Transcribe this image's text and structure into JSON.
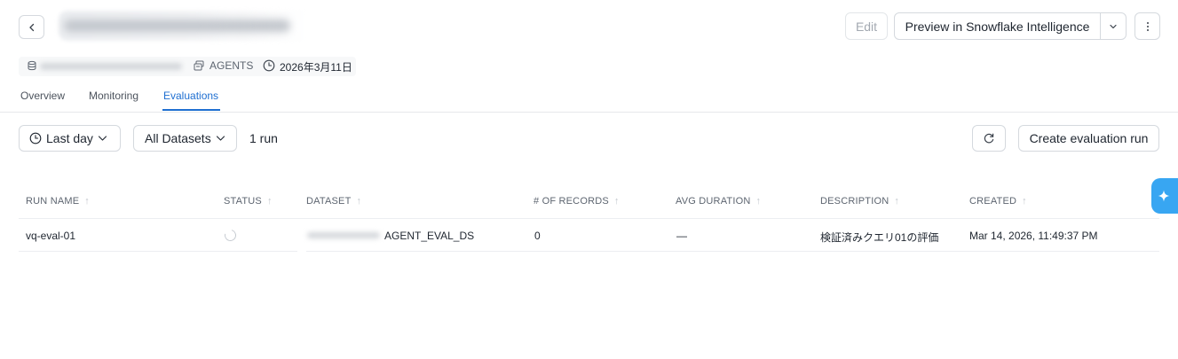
{
  "header": {
    "edit_label": "Edit",
    "preview_label": "Preview in Snowflake Intelligence"
  },
  "meta": {
    "type_label": "AGENTS",
    "date": "2026年3月11日"
  },
  "tabs": [
    {
      "label": "Overview"
    },
    {
      "label": "Monitoring"
    },
    {
      "label": "Evaluations",
      "active": true
    }
  ],
  "toolbar": {
    "range_label": "Last day",
    "datasets_label": "All Datasets",
    "run_count": "1 run",
    "create_label": "Create evaluation run"
  },
  "table": {
    "columns": [
      "RUN NAME",
      "STATUS",
      "DATASET",
      "# OF RECORDS",
      "AVG DURATION",
      "DESCRIPTION",
      "CREATED"
    ],
    "rows": [
      {
        "run_name": "vq-eval-01",
        "status": "running",
        "dataset": "AGENT_EVAL_DS",
        "records": "0",
        "avg_duration": "—",
        "description": "検証済みクエリ01の評価",
        "created": "Mar 14, 2026, 11:49:37 PM"
      }
    ]
  },
  "colors": {
    "accent": "#1f6fd1",
    "ai_button": "#38a6f2",
    "text": "#1e252f",
    "muted": "#5d6570"
  },
  "icons": [
    "chevron-left-icon",
    "chevron-down-icon",
    "more-vertical-icon",
    "database-icon",
    "agents-icon",
    "clock-icon",
    "refresh-icon",
    "sparkle-icon",
    "sort-arrow-icon",
    "spinner-icon"
  ]
}
